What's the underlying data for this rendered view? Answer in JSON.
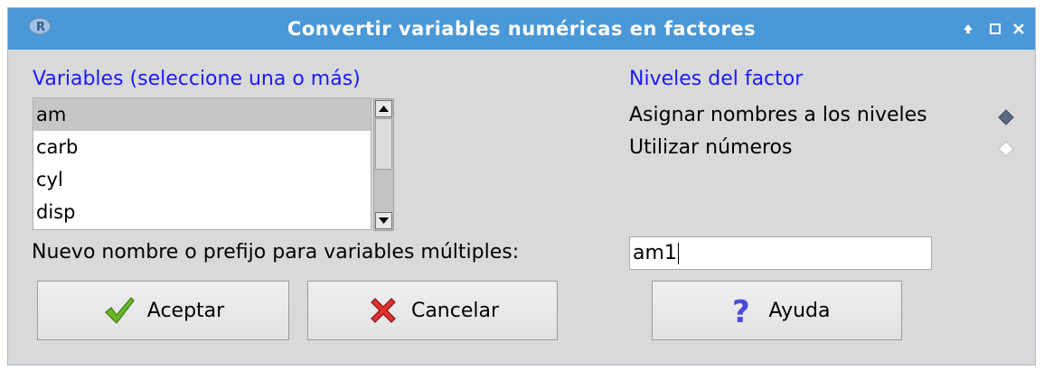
{
  "window": {
    "title": "Convertir variables numéricas en factores"
  },
  "variables": {
    "label": "Variables (seleccione una o más)",
    "items": [
      "am",
      "carb",
      "cyl",
      "disp"
    ],
    "selected": "am"
  },
  "levels": {
    "label": "Niveles del factor",
    "options": [
      {
        "label": "Asignar nombres a los niveles",
        "checked": true
      },
      {
        "label": "Utilizar números",
        "checked": false
      }
    ]
  },
  "name_field": {
    "label": "Nuevo nombre o prefijo para variables múltiples:",
    "value": "am1"
  },
  "buttons": {
    "ok": "Aceptar",
    "cancel": "Cancelar",
    "help": "Ayuda"
  },
  "colors": {
    "titlebar": "#4a98d8",
    "label_blue": "#1a1aff",
    "ok_icon": "#5aa820",
    "cancel_icon": "#d62020",
    "help_icon": "#4a4ad8"
  },
  "icons": {
    "app": "r-logo-icon",
    "maximize": "maximize-icon",
    "restore": "restore-icon",
    "close": "close-icon",
    "ok": "check-icon",
    "cancel": "x-icon",
    "help": "question-icon"
  }
}
